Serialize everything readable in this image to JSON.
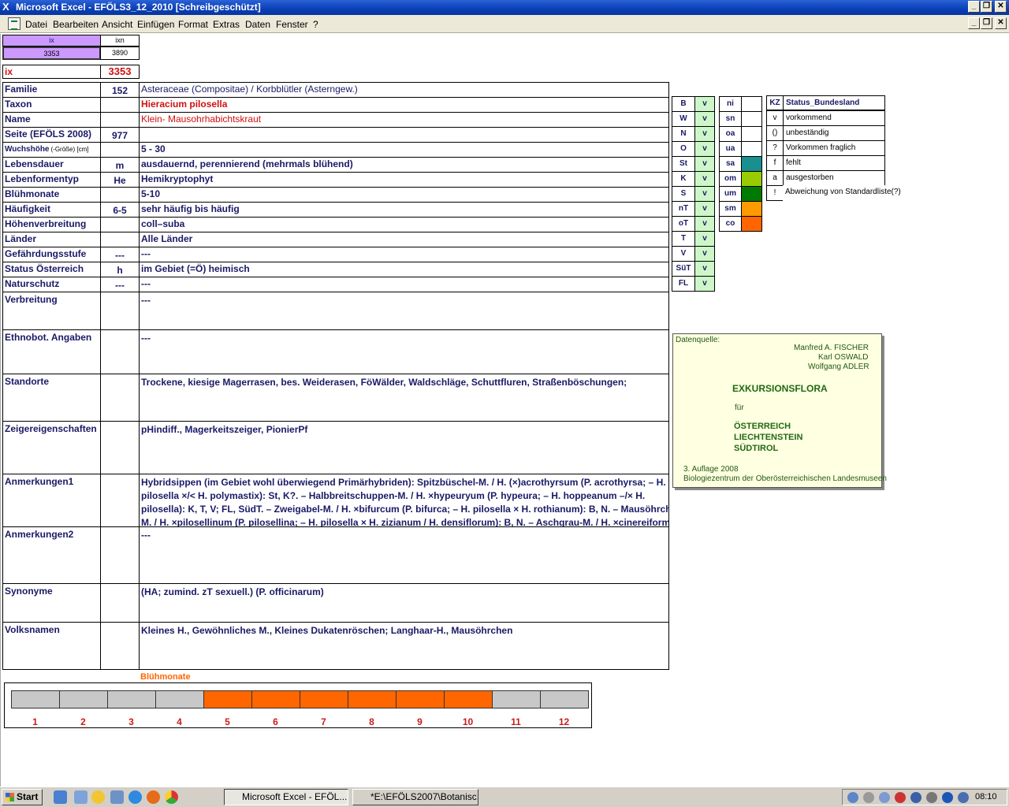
{
  "window": {
    "title": "Microsoft Excel - EFÖLS3_12_2010  [Schreibgeschützt]",
    "controls": [
      "_",
      "❐",
      "✕"
    ]
  },
  "menu": {
    "items": [
      "Datei",
      "Bearbeiten",
      "Ansicht",
      "Einfügen",
      "Format",
      "Extras",
      "Daten",
      "Fenster",
      "?"
    ]
  },
  "index": {
    "ix_header": "ix",
    "ixn_header": "ixn",
    "ix_value": "3353",
    "ixn_value": "3890",
    "ix_label": "ix",
    "ix_big": "3353"
  },
  "rows": [
    {
      "label": "Familie",
      "code": "152",
      "value": "Asteraceae (Compositae)  /  Korbblütler (Asterngew.)"
    },
    {
      "label": "Taxon",
      "code": "",
      "value": "Hieracium pilosella"
    },
    {
      "label": "Name",
      "code": "",
      "value": "Klein- Mausohrhabichtskraut"
    },
    {
      "label": "Seite (EFÖLS 2008)",
      "code": "977",
      "value": ""
    },
    {
      "label": "Wuchshöhe",
      "label_suffix": "(-Größe) [cm]",
      "code": "",
      "value": "5 - 30"
    },
    {
      "label": "Lebensdauer",
      "code": "m",
      "value": "ausdauernd, perennierend (mehrmals blühend)"
    },
    {
      "label": "Lebenformentyp",
      "code": "He",
      "value": "Hemikryptophyt"
    },
    {
      "label": "Blühmonate",
      "code": "",
      "value": "5-10"
    },
    {
      "label": "Häufigkeit",
      "code": "6-5",
      "value": "sehr häufig bis häufig"
    },
    {
      "label": "Höhenverbreitung",
      "code": "",
      "value": "coll–suba"
    },
    {
      "label": "Länder",
      "code": "",
      "value": "Alle Länder"
    },
    {
      "label": "Gefährdungsstufe",
      "code": "---",
      "value": "---"
    },
    {
      "label": "Status Österreich",
      "code": "h",
      "value": "im Gebiet (=Ö) heimisch"
    },
    {
      "label": "Naturschutz",
      "code": "---",
      "value": "---"
    }
  ],
  "tall_rows": [
    {
      "label": "Verbreitung",
      "value": "---"
    },
    {
      "label": "Ethnobot. Angaben",
      "value": "---"
    },
    {
      "label": "Standorte",
      "value": "Trockene, kiesige Magerrasen, bes. Weiderasen, FöWälder, Waldschläge, Schuttfluren, Straßenböschungen;"
    },
    {
      "label": "Zeigereigenschaften",
      "value": "pHindiff., Magerkeitszeiger, PionierPf"
    },
    {
      "label": "Anmerkungen1",
      "value_lines": [
        "Hybridsippen (im Gebiet wohl überwiegend Primärhybriden): Spitzbüschel-M. / H. (×)acrothyrsum (P. acrothyrsa; – H.",
        "pilosella ×/< H. polymastix): St, K?. – Halbbreitschuppen-M. / H. ×hypeuryum (P. hypeura; – H. hoppeanum –/× H.",
        "pilosella): K, T, V; FL, SüdT. – Zweigabel-M. / H. ×bifurcum (P. bifurca; – H. pilosella × H. rothianum): B, N. – Mausöhrchen-",
        "M. / H. ×pilosellinum (P. pilosellina; – H. pilosella × H. zizianum / H. densiflorum): B, N. – Aschgrau-M. / H. ×cinereiforme"
      ]
    },
    {
      "label": "Anmerkungen2",
      "value": "---"
    },
    {
      "label": "Synonyme",
      "value": "(HA; zumind. zT sexuell.) (P. officinarum)"
    },
    {
      "label": "Volksnamen",
      "value": "Kleines H., Gewöhnliches M.,  Kleines Dukatenröschen; Langhaar-H., Mausöhrchen"
    }
  ],
  "states": {
    "codes": [
      "B",
      "W",
      "N",
      "O",
      "St",
      "K",
      "S",
      "nT",
      "oT",
      "T",
      "V",
      "SüT",
      "FL"
    ],
    "values": [
      "v",
      "v",
      "v",
      "v",
      "v",
      "v",
      "v",
      "v",
      "v",
      "v",
      "v",
      "v",
      "v"
    ]
  },
  "zones": {
    "codes": [
      "ni",
      "sn",
      "oa",
      "ua",
      "sa",
      "om",
      "um",
      "sm",
      "co"
    ],
    "colors": [
      "#ffffff",
      "#ffffff",
      "#ffffff",
      "#ffffff",
      "#1a8f8f",
      "#99cc00",
      "#007a00",
      "#ff9a00",
      "#ff6600"
    ]
  },
  "status": {
    "header_kz": "KZ",
    "header_label": "Status_Bundesland",
    "items": [
      {
        "kz": "v",
        "text": "vorkommend"
      },
      {
        "kz": "()",
        "text": "unbeständig"
      },
      {
        "kz": "?",
        "text": "Vorkommen fraglich"
      },
      {
        "kz": "f",
        "text": "fehlt"
      },
      {
        "kz": "a",
        "text": "ausgestorben"
      },
      {
        "kz": "!",
        "text": "Abweichung von Standardliste(?)"
      }
    ]
  },
  "source": {
    "label": "Datenquelle:",
    "authors": [
      "Manfred A. FISCHER",
      "Karl OSWALD",
      "Wolfgang ADLER"
    ],
    "title": "EXKURSIONSFLORA",
    "fuer": "für",
    "countries": [
      "ÖSTERREICH",
      "LIECHTENSTEIN",
      "SÜDTIROL"
    ],
    "edition": "3. Auflage 2008",
    "publisher": "Biologiezentrum der Oberösterreichischen Landesmuseen"
  },
  "bluehmonate": {
    "title": "Blühmonate",
    "months": [
      "1",
      "2",
      "3",
      "4",
      "5",
      "6",
      "7",
      "8",
      "9",
      "10",
      "11",
      "12"
    ],
    "flowering": [
      false,
      false,
      false,
      false,
      true,
      true,
      true,
      true,
      true,
      true,
      false,
      false
    ],
    "color_on": "#ff6600",
    "color_off": "#c8c8c8"
  },
  "taskbar": {
    "start": "Start",
    "tasks": [
      "Microsoft Excel - EFÖL...",
      "*E:\\EFÖLS2007\\Botanisc..."
    ],
    "time": "08:10"
  }
}
